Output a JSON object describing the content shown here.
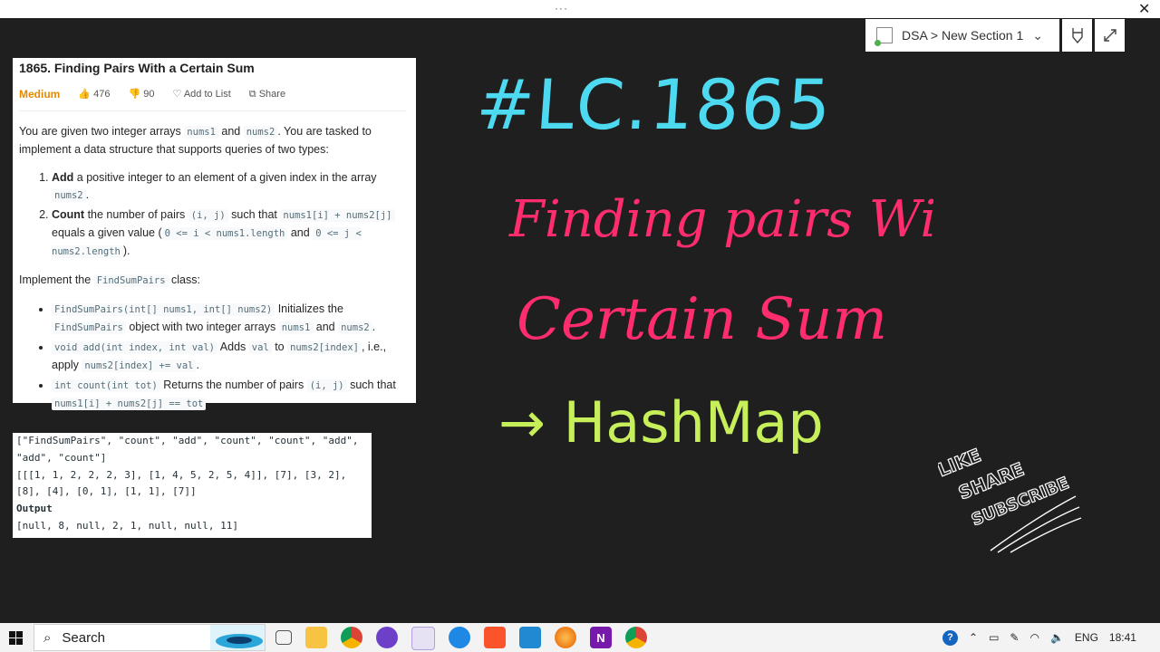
{
  "window": {
    "dots": "···",
    "close": "✕"
  },
  "notebook": {
    "section": "DSA > New Section 1",
    "chevron": "⌄"
  },
  "problem": {
    "title": "1865. Finding Pairs With a Certain Sum",
    "difficulty": "Medium",
    "likes": "476",
    "dislikes": "90",
    "add_to_list": "Add to List",
    "share": "Share",
    "p1": {
      "t1": "You are given two integer arrays ",
      "c1": "nums1",
      "t2": " and ",
      "c2": "nums2",
      "t3": ". You are tasked to implement a data structure that supports queries of two types:"
    },
    "item1": {
      "b": "Add",
      "t": " a positive integer to an element of a given index in the array ",
      "c": "nums2",
      "t2": "."
    },
    "item2": {
      "b": "Count",
      "t1": " the number of pairs ",
      "c1": "(i, j)",
      "t2": " such that ",
      "c2": "nums1[i] + nums2[j]",
      "t3": " equals a given value (",
      "c3": "0 <= i < nums1.length",
      "t4": " and ",
      "c4": "0 <= j < nums2.length",
      "t5": ")."
    },
    "implement": {
      "t1": "Implement the ",
      "c": "FindSumPairs",
      "t2": " class:"
    },
    "b1": {
      "c1": "FindSumPairs(int[] nums1, int[] nums2)",
      "t1": " Initializes the ",
      "c2": "FindSumPairs",
      "t2": " object with two integer arrays ",
      "c3": "nums1",
      "t3": " and ",
      "c4": "nums2",
      "t4": "."
    },
    "b2": {
      "c1": "void add(int index, int val)",
      "t1": " Adds ",
      "c2": "val",
      "t2": " to ",
      "c3": "nums2[index]",
      "t3": ", i.e., apply ",
      "c4": "nums2[index] += val",
      "t4": "."
    },
    "b3": {
      "c1": "int count(int tot)",
      "t1": " Returns the number of pairs ",
      "c2": "(i, j)",
      "t2": " such that ",
      "c3": "nums1[i] + nums2[j] == tot",
      "t3": "."
    }
  },
  "example": {
    "input": "[\"FindSumPairs\", \"count\", \"add\", \"count\", \"count\", \"add\", \"add\", \"count\"]\n[[[1, 1, 2, 2, 2, 3], [1, 4, 5, 2, 5, 4]], [7], [3, 2], [8], [4], [0, 1], [1, 1], [7]]",
    "output_label": "Output",
    "output": "[null, 8, null, 2, 1, null, null, 11]"
  },
  "handwriting": {
    "line1": "#LC.1865",
    "line2": "Finding pairs With",
    "line3": "Certain Sum",
    "line4": "→ HashMap",
    "colors": {
      "cyan": "#4dd9f0",
      "pink": "#ff2d6e",
      "lime": "#c6ef5a",
      "white": "#ffffff"
    },
    "sticker": [
      "LIKE",
      "SHARE",
      "SUBSCRIBE"
    ]
  },
  "taskbar": {
    "search": "Search",
    "lang": "ENG",
    "time": "18:41",
    "icons": [
      "task-view-icon",
      "file-explorer-icon",
      "chrome-icon",
      "github-icon",
      "paint-icon",
      "todo-icon",
      "brave-icon",
      "vscode-icon",
      "firefox-icon",
      "onenote-icon",
      "chrome-icon"
    ]
  }
}
